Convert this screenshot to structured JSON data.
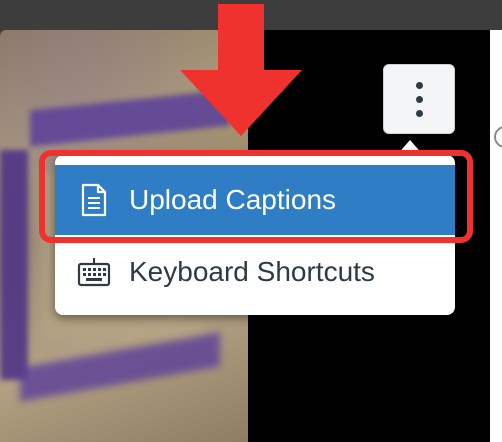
{
  "menu": {
    "items": [
      {
        "label": "Upload Captions",
        "icon": "document-icon",
        "active": true
      },
      {
        "label": "Keyboard Shortcuts",
        "icon": "keyboard-icon",
        "active": false
      }
    ],
    "active_color": "#2f7ec5"
  },
  "annotation": {
    "arrow_color": "#f0322e",
    "highlight_color": "#f0322e"
  },
  "kebab_button": {
    "icon": "more-vertical-icon"
  }
}
